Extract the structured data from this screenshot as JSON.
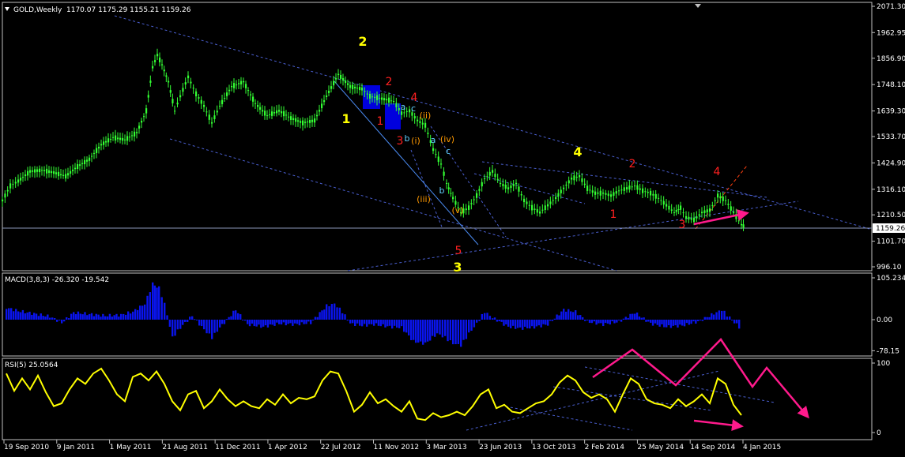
{
  "chart_data": {
    "type": "line",
    "title": "GOLD,Weekly",
    "ohlc_header": "1170.07 1175.29 1155.21 1159.26",
    "current_price_label": "1159.26",
    "price_axis": {
      "ticks": [
        "2071.30",
        "1962.95",
        "1856.90",
        "1748.10",
        "1639.30",
        "1533.70",
        "1424.90",
        "1316.10",
        "1210.50",
        "1101.70",
        "996.10"
      ]
    },
    "macd_axis": {
      "ticks": [
        "105.234",
        "0.00",
        "-78.15"
      ]
    },
    "rsi_axis": {
      "ticks": [
        "100",
        "0"
      ]
    },
    "macd_title": "MACD(3,8,3) -26.320 -19.542",
    "rsi_title": "RSI(5) 25.0564",
    "x_labels": [
      "19 Sep 2010",
      "9 Jan 2011",
      "1 May 2011",
      "21 Aug 2011",
      "11 Dec 2011",
      "1 Apr 2012",
      "22 Jul 2012",
      "11 Nov 2012",
      "3 Mar 2013",
      "23 Jun 2013",
      "13 Oct 2013",
      "2 Feb 2014",
      "25 May 2014",
      "14 Sep 2014",
      "4 Jan 2015"
    ],
    "price_series": {
      "points": [
        [
          0,
          1270
        ],
        [
          10,
          1330
        ],
        [
          20,
          1350
        ],
        [
          35,
          1390
        ],
        [
          50,
          1395
        ],
        [
          65,
          1385
        ],
        [
          80,
          1370
        ],
        [
          95,
          1410
        ],
        [
          110,
          1440
        ],
        [
          125,
          1500
        ],
        [
          140,
          1530
        ],
        [
          155,
          1520
        ],
        [
          170,
          1550
        ],
        [
          182,
          1640
        ],
        [
          190,
          1820
        ],
        [
          196,
          1870
        ],
        [
          202,
          1830
        ],
        [
          210,
          1760
        ],
        [
          218,
          1640
        ],
        [
          225,
          1700
        ],
        [
          235,
          1780
        ],
        [
          245,
          1710
        ],
        [
          255,
          1660
        ],
        [
          265,
          1590
        ],
        [
          275,
          1660
        ],
        [
          290,
          1740
        ],
        [
          305,
          1760
        ],
        [
          320,
          1670
        ],
        [
          335,
          1620
        ],
        [
          350,
          1640
        ],
        [
          365,
          1610
        ],
        [
          380,
          1590
        ],
        [
          395,
          1600
        ],
        [
          410,
          1700
        ],
        [
          425,
          1790
        ],
        [
          440,
          1740
        ],
        [
          455,
          1730
        ],
        [
          465,
          1700
        ],
        [
          480,
          1690
        ],
        [
          495,
          1680
        ],
        [
          505,
          1630
        ],
        [
          515,
          1640
        ],
        [
          525,
          1600
        ],
        [
          535,
          1580
        ],
        [
          545,
          1480
        ],
        [
          555,
          1420
        ],
        [
          562,
          1340
        ],
        [
          570,
          1280
        ],
        [
          580,
          1220
        ],
        [
          590,
          1240
        ],
        [
          600,
          1290
        ],
        [
          610,
          1360
        ],
        [
          620,
          1390
        ],
        [
          630,
          1340
        ],
        [
          640,
          1320
        ],
        [
          650,
          1340
        ],
        [
          660,
          1270
        ],
        [
          670,
          1240
        ],
        [
          680,
          1220
        ],
        [
          690,
          1250
        ],
        [
          700,
          1280
        ],
        [
          710,
          1320
        ],
        [
          720,
          1360
        ],
        [
          730,
          1370
        ],
        [
          740,
          1320
        ],
        [
          750,
          1300
        ],
        [
          760,
          1300
        ],
        [
          770,
          1290
        ],
        [
          780,
          1310
        ],
        [
          790,
          1320
        ],
        [
          800,
          1330
        ],
        [
          810,
          1310
        ],
        [
          820,
          1300
        ],
        [
          830,
          1280
        ],
        [
          840,
          1250
        ],
        [
          850,
          1220
        ],
        [
          858,
          1240
        ],
        [
          865,
          1200
        ],
        [
          875,
          1190
        ],
        [
          885,
          1220
        ],
        [
          895,
          1230
        ],
        [
          905,
          1290
        ],
        [
          915,
          1270
        ],
        [
          925,
          1220
        ],
        [
          935,
          1170
        ],
        [
          940,
          1159
        ]
      ]
    },
    "macd_series": {
      "points": [
        [
          5,
          30
        ],
        [
          20,
          22
        ],
        [
          40,
          15
        ],
        [
          60,
          8
        ],
        [
          75,
          -8
        ],
        [
          90,
          18
        ],
        [
          110,
          14
        ],
        [
          130,
          10
        ],
        [
          150,
          12
        ],
        [
          165,
          20
        ],
        [
          180,
          40
        ],
        [
          190,
          90
        ],
        [
          198,
          80
        ],
        [
          205,
          40
        ],
        [
          215,
          -45
        ],
        [
          225,
          -20
        ],
        [
          240,
          10
        ],
        [
          255,
          -25
        ],
        [
          265,
          -45
        ],
        [
          275,
          -20
        ],
        [
          295,
          25
        ],
        [
          310,
          -12
        ],
        [
          330,
          -18
        ],
        [
          350,
          -10
        ],
        [
          370,
          -12
        ],
        [
          390,
          -8
        ],
        [
          410,
          35
        ],
        [
          420,
          40
        ],
        [
          430,
          20
        ],
        [
          440,
          -10
        ],
        [
          455,
          -15
        ],
        [
          470,
          -12
        ],
        [
          490,
          -18
        ],
        [
          505,
          -20
        ],
        [
          520,
          -55
        ],
        [
          535,
          -60
        ],
        [
          550,
          -35
        ],
        [
          560,
          -45
        ],
        [
          570,
          -60
        ],
        [
          580,
          -65
        ],
        [
          590,
          -35
        ],
        [
          600,
          -10
        ],
        [
          610,
          20
        ],
        [
          620,
          5
        ],
        [
          640,
          -18
        ],
        [
          655,
          -22
        ],
        [
          670,
          -20
        ],
        [
          690,
          -12
        ],
        [
          710,
          25
        ],
        [
          725,
          20
        ],
        [
          740,
          -5
        ],
        [
          760,
          -12
        ],
        [
          780,
          -5
        ],
        [
          800,
          18
        ],
        [
          820,
          -10
        ],
        [
          840,
          -18
        ],
        [
          860,
          -15
        ],
        [
          880,
          -5
        ],
        [
          900,
          15
        ],
        [
          910,
          25
        ],
        [
          920,
          5
        ],
        [
          935,
          -25
        ]
      ]
    },
    "rsi_series": {
      "points": [
        [
          5,
          85
        ],
        [
          15,
          60
        ],
        [
          25,
          78
        ],
        [
          35,
          62
        ],
        [
          45,
          82
        ],
        [
          55,
          58
        ],
        [
          65,
          38
        ],
        [
          75,
          42
        ],
        [
          85,
          62
        ],
        [
          95,
          78
        ],
        [
          105,
          70
        ],
        [
          115,
          85
        ],
        [
          125,
          92
        ],
        [
          135,
          75
        ],
        [
          145,
          55
        ],
        [
          155,
          45
        ],
        [
          165,
          80
        ],
        [
          175,
          85
        ],
        [
          185,
          75
        ],
        [
          195,
          88
        ],
        [
          205,
          70
        ],
        [
          215,
          45
        ],
        [
          225,
          32
        ],
        [
          235,
          55
        ],
        [
          245,
          60
        ],
        [
          255,
          35
        ],
        [
          265,
          45
        ],
        [
          275,
          62
        ],
        [
          285,
          48
        ],
        [
          295,
          38
        ],
        [
          305,
          45
        ],
        [
          315,
          38
        ],
        [
          325,
          35
        ],
        [
          335,
          48
        ],
        [
          345,
          40
        ],
        [
          355,
          55
        ],
        [
          365,
          42
        ],
        [
          375,
          50
        ],
        [
          385,
          48
        ],
        [
          395,
          52
        ],
        [
          405,
          75
        ],
        [
          415,
          88
        ],
        [
          425,
          85
        ],
        [
          435,
          60
        ],
        [
          445,
          30
        ],
        [
          455,
          40
        ],
        [
          465,
          58
        ],
        [
          475,
          42
        ],
        [
          485,
          48
        ],
        [
          495,
          38
        ],
        [
          505,
          30
        ],
        [
          515,
          45
        ],
        [
          525,
          20
        ],
        [
          535,
          18
        ],
        [
          545,
          28
        ],
        [
          555,
          22
        ],
        [
          565,
          25
        ],
        [
          575,
          30
        ],
        [
          585,
          25
        ],
        [
          595,
          38
        ],
        [
          605,
          55
        ],
        [
          615,
          62
        ],
        [
          625,
          35
        ],
        [
          635,
          40
        ],
        [
          645,
          30
        ],
        [
          655,
          28
        ],
        [
          665,
          35
        ],
        [
          675,
          42
        ],
        [
          685,
          45
        ],
        [
          695,
          55
        ],
        [
          705,
          72
        ],
        [
          715,
          82
        ],
        [
          725,
          75
        ],
        [
          735,
          58
        ],
        [
          745,
          50
        ],
        [
          755,
          55
        ],
        [
          765,
          48
        ],
        [
          775,
          30
        ],
        [
          785,
          55
        ],
        [
          795,
          78
        ],
        [
          805,
          70
        ],
        [
          815,
          48
        ],
        [
          825,
          42
        ],
        [
          835,
          40
        ],
        [
          845,
          35
        ],
        [
          855,
          48
        ],
        [
          865,
          38
        ],
        [
          875,
          45
        ],
        [
          885,
          55
        ],
        [
          895,
          42
        ],
        [
          905,
          78
        ],
        [
          915,
          70
        ],
        [
          925,
          40
        ],
        [
          935,
          25
        ]
      ]
    },
    "annotations": [
      {
        "text": "2",
        "color": "#ffff00",
        "fx": 459,
        "fy": 58
      },
      {
        "text": "1",
        "color": "#ffff00",
        "fx": 438,
        "fy": 156
      },
      {
        "text": "4",
        "color": "#ffff00",
        "fx": 731,
        "fy": 198
      },
      {
        "text": "3",
        "color": "#ffff00",
        "fx": 579,
        "fy": 344
      },
      {
        "text": "2",
        "color": "#ff2020",
        "fx": 492,
        "fy": 108
      },
      {
        "text": "4",
        "color": "#ff2020",
        "fx": 524,
        "fy": 128
      },
      {
        "text": "1",
        "color": "#ff2020",
        "fx": 481,
        "fy": 158
      },
      {
        "text": "3",
        "color": "#ff2020",
        "fx": 506,
        "fy": 183
      },
      {
        "text": "5",
        "color": "#ff2020",
        "fx": 580,
        "fy": 322
      },
      {
        "text": "2",
        "color": "#ff2020",
        "fx": 800,
        "fy": 212
      },
      {
        "text": "1",
        "color": "#ff2020",
        "fx": 776,
        "fy": 276
      },
      {
        "text": "4",
        "color": "#ff2020",
        "fx": 907,
        "fy": 222
      },
      {
        "text": "3",
        "color": "#ff2020",
        "fx": 863,
        "fy": 289
      },
      {
        "text": "(ii)",
        "color": "#ff9900",
        "fx": 538,
        "fy": 150
      },
      {
        "text": "(i)",
        "color": "#ff9900",
        "fx": 526,
        "fy": 182
      },
      {
        "text": "(iv)",
        "color": "#ff9900",
        "fx": 566,
        "fy": 180
      },
      {
        "text": "(iii)",
        "color": "#ff9900",
        "fx": 536,
        "fy": 256
      },
      {
        "text": "(v)",
        "color": "#ff9900",
        "fx": 579,
        "fy": 270
      },
      {
        "text": "a",
        "color": "#60d0ff",
        "fx": 510,
        "fy": 139
      },
      {
        "text": "c",
        "color": "#60d0ff",
        "fx": 523,
        "fy": 141
      },
      {
        "text": "b",
        "color": "#60d0ff",
        "fx": 515,
        "fy": 179
      },
      {
        "text": "a",
        "color": "#60d0ff",
        "fx": 548,
        "fy": 181
      },
      {
        "text": "c",
        "color": "#60d0ff",
        "fx": 567,
        "fy": 195
      },
      {
        "text": "b",
        "color": "#60d0ff",
        "fx": 559,
        "fy": 245
      }
    ]
  }
}
